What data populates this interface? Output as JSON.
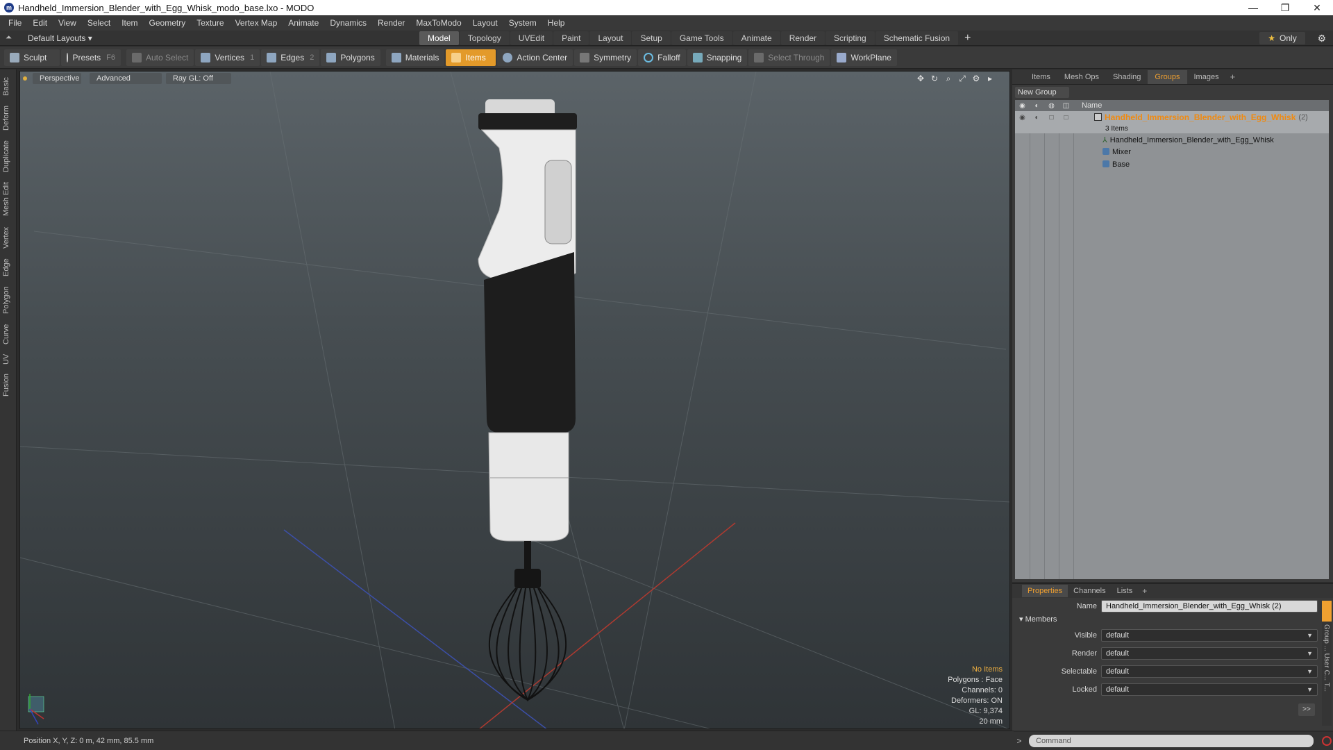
{
  "window": {
    "title": "Handheld_Immersion_Blender_with_Egg_Whisk_modo_base.lxo - MODO",
    "controls": [
      "—",
      "❐",
      "✕"
    ]
  },
  "menu": [
    "File",
    "Edit",
    "View",
    "Select",
    "Item",
    "Geometry",
    "Texture",
    "Vertex Map",
    "Animate",
    "Dynamics",
    "Render",
    "MaxToModo",
    "Layout",
    "System",
    "Help"
  ],
  "layout_selector": "Default Layouts ▾",
  "tabs": [
    {
      "label": "Model",
      "active": true
    },
    {
      "label": "Topology"
    },
    {
      "label": "UVEdit"
    },
    {
      "label": "Paint"
    },
    {
      "label": "Layout"
    },
    {
      "label": "Setup"
    },
    {
      "label": "Game Tools"
    },
    {
      "label": "Animate"
    },
    {
      "label": "Render"
    },
    {
      "label": "Scripting"
    },
    {
      "label": "Schematic Fusion"
    }
  ],
  "only_label": "Only",
  "toolbar": {
    "sculpt": "Sculpt",
    "presets": "Presets",
    "presets_key": "F6",
    "auto_select": "Auto Select",
    "vertices": "Vertices",
    "vertices_key": "1",
    "edges": "Edges",
    "edges_key": "2",
    "polygons": "Polygons",
    "materials": "Materials",
    "items": "Items",
    "action_center": "Action Center",
    "symmetry": "Symmetry",
    "falloff": "Falloff",
    "snapping": "Snapping",
    "select_through": "Select Through",
    "workplane": "WorkPlane"
  },
  "left_tabs": [
    "Basic",
    "Deform",
    "Duplicate",
    "Mesh Edit",
    "Vertex",
    "Edge",
    "Polygon",
    "Curve",
    "UV",
    "Fusion"
  ],
  "viewport": {
    "perspective": "Perspective",
    "advanced": "Advanced",
    "raygl": "Ray GL: Off",
    "stats": {
      "no_items": "No Items",
      "polygons": "Polygons : Face",
      "channels": "Channels: 0",
      "deformers": "Deformers: ON",
      "gl": "GL: 9,374",
      "scale": "20 mm"
    }
  },
  "status": "Position X, Y, Z:  0 m, 42 mm, 85.5 mm",
  "right_panel": {
    "tabs": [
      {
        "label": "Items"
      },
      {
        "label": "Mesh Ops"
      },
      {
        "label": "Shading"
      },
      {
        "label": "Groups",
        "active": true
      },
      {
        "label": "Images"
      }
    ],
    "new_group": "New Group",
    "name_header": "Name",
    "group_name": "Handheld_Immersion_Blender_with_Egg_Whisk",
    "group_count": "(2)",
    "item_count": "3 Items",
    "members": [
      {
        "label": "Handheld_Immersion_Blender_with_Egg_Whisk",
        "type": "locator"
      },
      {
        "label": "Mixer",
        "type": "mesh"
      },
      {
        "label": "Base",
        "type": "mesh"
      }
    ]
  },
  "properties": {
    "tabs": [
      {
        "label": "Properties",
        "active": true
      },
      {
        "label": "Channels"
      },
      {
        "label": "Lists"
      }
    ],
    "name_label": "Name",
    "name_value": "Handheld_Immersion_Blender_with_Egg_Whisk (2)",
    "members_label": "Members",
    "visible_label": "Visible",
    "visible_value": "default",
    "render_label": "Render",
    "render_value": "default",
    "selectable_label": "Selectable",
    "selectable_value": "default",
    "locked_label": "Locked",
    "locked_value": "default",
    "more": ">>",
    "side_strip": "Group ... User C... T..."
  },
  "command_placeholder": "Command"
}
